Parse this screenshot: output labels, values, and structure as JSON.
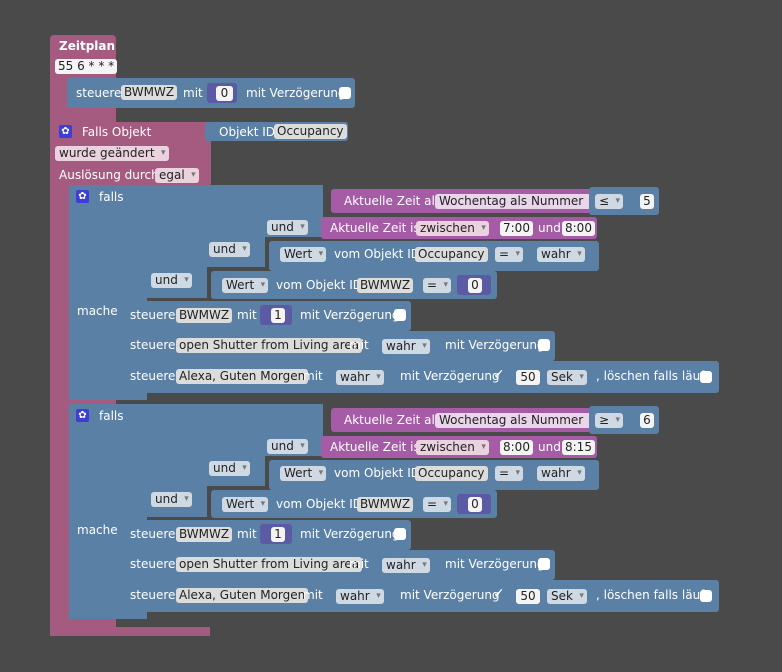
{
  "zeitplan": {
    "title": "Zeitplan",
    "cron": "55 6 * * *"
  },
  "steuere1": {
    "label": "steuere",
    "target": "BWMWZ",
    "mit": "mit",
    "value": "0",
    "delay_label": "mit Verzögerung"
  },
  "falls_objekt": {
    "title": "Falls Objekt",
    "objekt_id_label": "Objekt ID",
    "objekt_id_value": "Occupancy",
    "changed": "wurde geändert",
    "ausloesung_label": "Auslösung durch",
    "ausloesung_value": "egal"
  },
  "blocks": [
    {
      "falls": "falls",
      "mache": "mache",
      "und_outer": "und",
      "und_mid": "und",
      "und_inner": "und",
      "cond1": {
        "label": "Aktuelle Zeit als",
        "mode": "Wochentag als Nummer",
        "op": "≤",
        "value": "5"
      },
      "cond2": {
        "label": "Aktuelle Zeit ist",
        "mode": "zwischen",
        "from": "7:00",
        "und": "und",
        "to": "8:00"
      },
      "cond3": {
        "wert": "Wert",
        "vom": "vom Objekt ID",
        "obj": "Occupancy",
        "op": "=",
        "value": "wahr"
      },
      "cond4": {
        "wert": "Wert",
        "vom": "vom Objekt ID",
        "obj": "BWMWZ",
        "op": "=",
        "value": "0"
      },
      "act1": {
        "label": "steuere",
        "target": "BWMWZ",
        "mit": "mit",
        "value": "1",
        "delay": "mit Verzögerung"
      },
      "act2": {
        "label": "steuere",
        "target": "open Shutter from Living area",
        "mit": "mit",
        "value": "wahr",
        "delay": "mit Verzögerung"
      },
      "act3": {
        "label": "steuere",
        "target": "Alexa, Guten Morgen",
        "mit": "mit",
        "value": "wahr",
        "delay": "mit Verzögerung",
        "delay_value": "50",
        "unit": "Sek",
        "clear": ", löschen falls läuft"
      }
    },
    {
      "falls": "falls",
      "mache": "mache",
      "und_outer": "und",
      "und_mid": "und",
      "und_inner": "und",
      "cond1": {
        "label": "Aktuelle Zeit als",
        "mode": "Wochentag als Nummer",
        "op": "≥",
        "value": "6"
      },
      "cond2": {
        "label": "Aktuelle Zeit ist",
        "mode": "zwischen",
        "from": "8:00",
        "und": "und",
        "to": "8:15"
      },
      "cond3": {
        "wert": "Wert",
        "vom": "vom Objekt ID",
        "obj": "Occupancy",
        "op": "=",
        "value": "wahr"
      },
      "cond4": {
        "wert": "Wert",
        "vom": "vom Objekt ID",
        "obj": "BWMWZ",
        "op": "=",
        "value": "0"
      },
      "act1": {
        "label": "steuere",
        "target": "BWMWZ",
        "mit": "mit",
        "value": "1",
        "delay": "mit Verzögerung"
      },
      "act2": {
        "label": "steuere",
        "target": "open Shutter from Living area",
        "mit": "mit",
        "value": "wahr",
        "delay": "mit Verzögerung"
      },
      "act3": {
        "label": "steuere",
        "target": "Alexa, Guten Morgen",
        "mit": "mit",
        "value": "wahr",
        "delay": "mit Verzögerung",
        "delay_value": "50",
        "unit": "Sek",
        "clear": ", löschen falls läuft"
      }
    }
  ],
  "colors": {
    "schedule": "#a55b80",
    "logic": "#5b80a5",
    "time": "#a55ba5",
    "background": "#4a4a4a"
  }
}
